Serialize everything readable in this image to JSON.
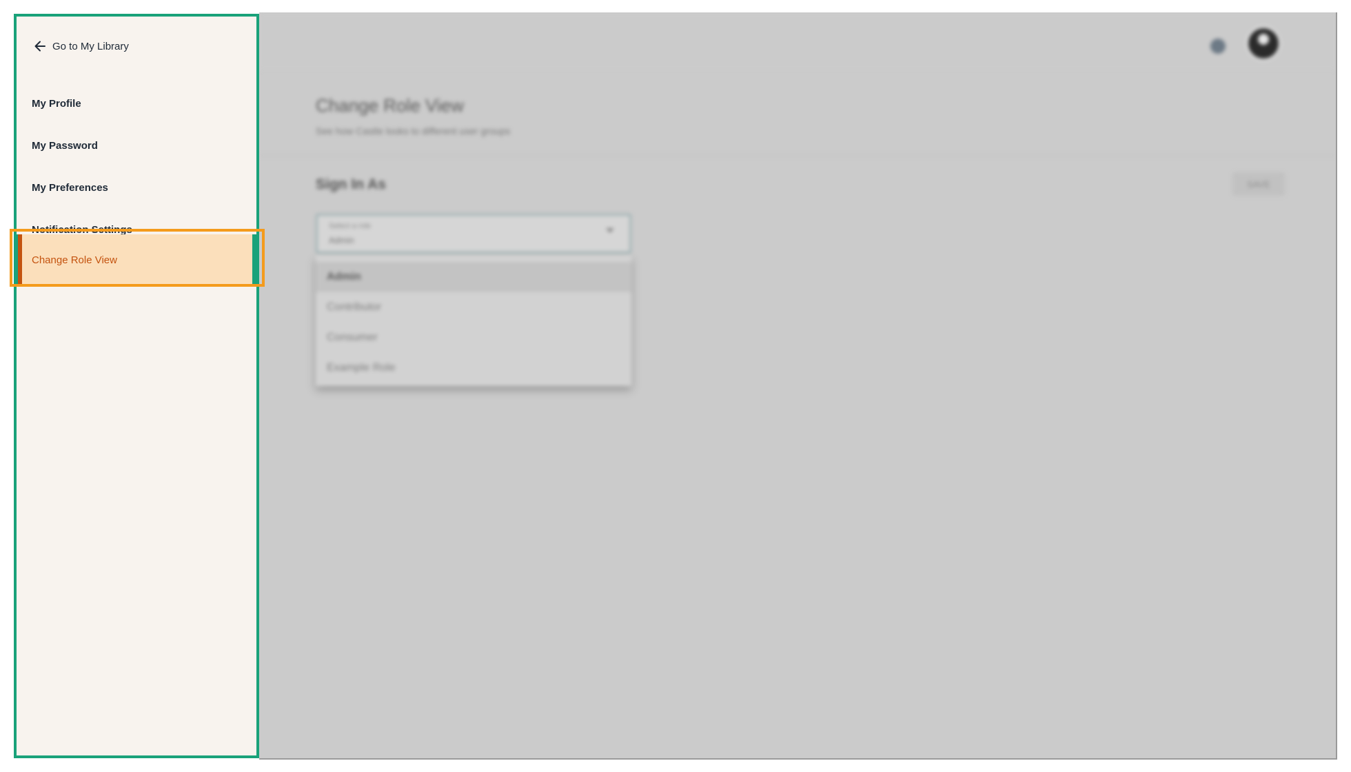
{
  "sidebar": {
    "back_link": {
      "label": "Go to My Library",
      "icon": "arrow-left-icon"
    },
    "items": [
      {
        "label": "My Profile"
      },
      {
        "label": "My Password"
      },
      {
        "label": "My Preferences"
      },
      {
        "label": "Notification Settings"
      },
      {
        "label": "Change Role View",
        "active": true
      }
    ]
  },
  "main": {
    "title": "Change Role View",
    "subtitle": "See how Castle looks to different user groups",
    "section_title": "Sign In As",
    "save_label": "SAVE",
    "role_select": {
      "label": "Select a role",
      "value": "Admin"
    },
    "dropdown_options": [
      {
        "label": "Admin",
        "selected": true
      },
      {
        "label": "Contributor"
      },
      {
        "label": "Consumer"
      },
      {
        "label": "Example Role"
      }
    ]
  },
  "colors": {
    "accent": "#1aa27a",
    "active_text": "#c4530f",
    "active_bg": "#fbdfbb",
    "highlight": "#f49b1c"
  }
}
